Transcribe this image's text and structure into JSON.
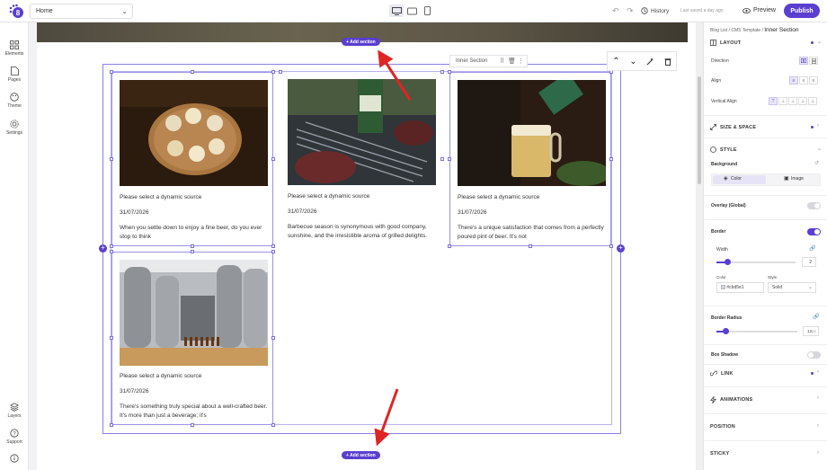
{
  "topbar": {
    "page_select": "Home",
    "history": "History",
    "last_saved": "Last saved a day ago",
    "preview": "Preview",
    "publish": "Publish"
  },
  "leftbar": {
    "elements": "Elements",
    "pages": "Pages",
    "theme": "Theme",
    "settings": "Settings",
    "layers": "Layers",
    "support": "Support"
  },
  "canvas": {
    "add_section_top": "+ Add section",
    "add_section_bottom": "+ Add section",
    "inner_section_tag": "Inner Section",
    "cards": [
      {
        "title": "Please select a dynamic source",
        "date": "31/07/2026",
        "text": "When you settle down to enjoy a fine beer, do you ever stop to think"
      },
      {
        "title": "Please select a dynamic source",
        "date": "31/07/2026",
        "text": "Barbecue season is synonymous with good company, sunshine, and the irresistible aroma of grilled delights."
      },
      {
        "title": "Please select a dynamic source",
        "date": "31/07/2026",
        "text": "There's a unique satisfaction that comes from a perfectly poured pint of beer. It's not"
      },
      {
        "title": "Please select a dynamic source",
        "date": "31/07/2026",
        "text": "There's something truly special about a well-crafted beer. It's more than just a beverage; it's"
      }
    ]
  },
  "panel": {
    "breadcrumb": [
      "Blog List",
      "CMS Template",
      "Inner Section"
    ],
    "layout": "LAYOUT",
    "direction": "Direction",
    "align": "Align",
    "vertical_align": "Vertical Align",
    "size_space": "SIZE & SPACE",
    "style": "STYLE",
    "background": "Background",
    "bg_color": "Color",
    "bg_image": "Image",
    "overlay": "Overlay (Global)",
    "border": "Border",
    "width_label": "Width",
    "width_value": "2",
    "color_label": "Color",
    "color_value": "#cbd5e1",
    "style_label": "Style",
    "style_value": "Solid",
    "border_radius": "Border Radius",
    "radius_value": "12",
    "radius_unit": "px",
    "box_shadow": "Box Shadow",
    "link": "LINK",
    "animations": "ANIMATIONS",
    "position": "POSITION",
    "sticky": "STICKY",
    "accent": "#5a3fd0"
  }
}
